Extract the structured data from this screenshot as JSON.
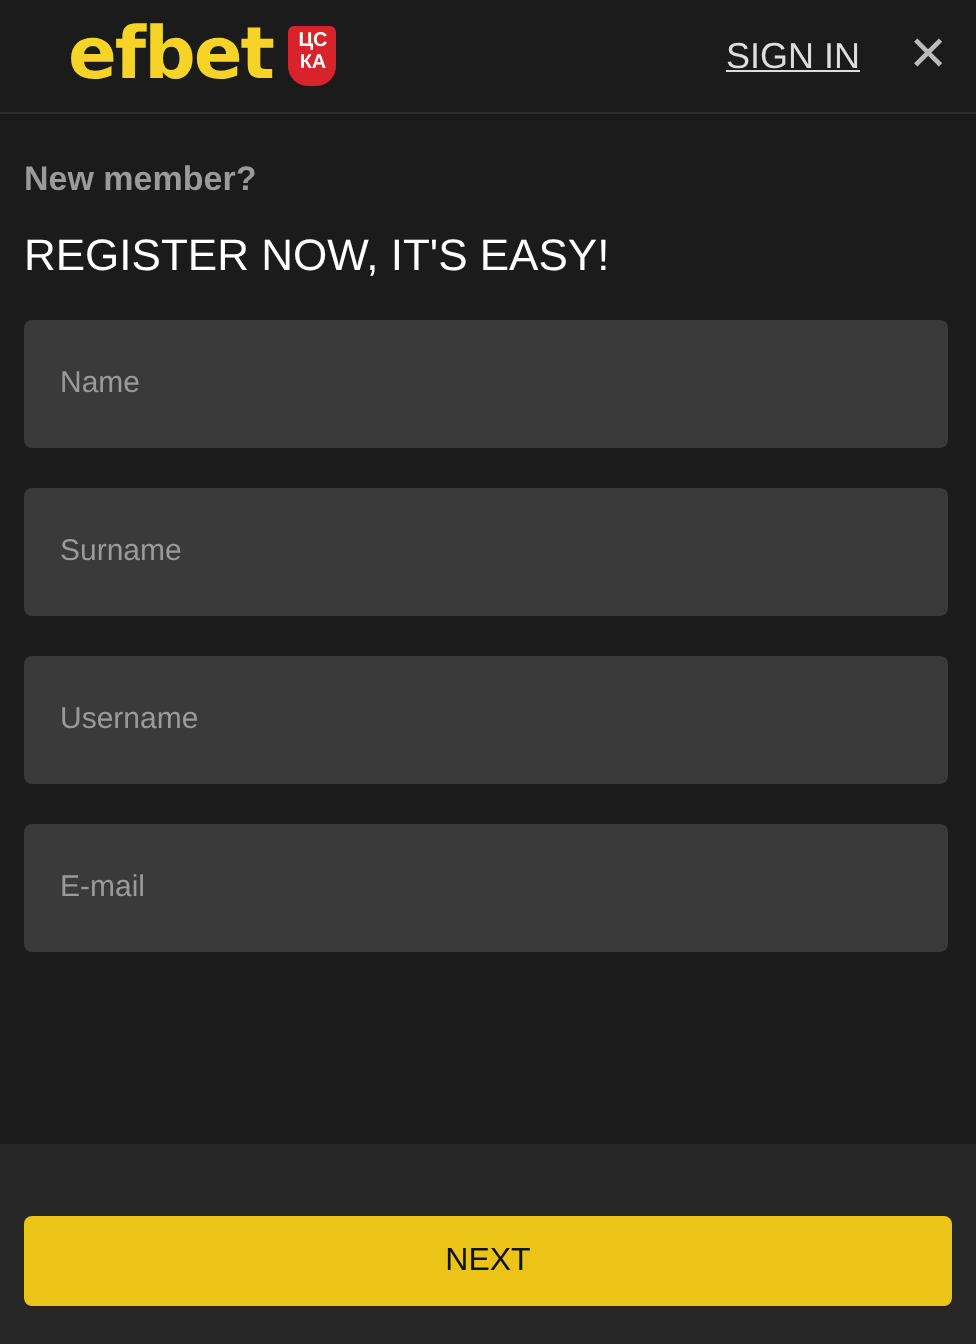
{
  "header": {
    "logo": "efbet",
    "badge": "ЦСКА",
    "sign_in": "SIGN IN",
    "close": "✕"
  },
  "intro": "New member?",
  "heading": "REGISTER NOW, IT'S EASY!",
  "fields": [
    {
      "placeholder": "Name"
    },
    {
      "placeholder": "Surname"
    },
    {
      "placeholder": "Username"
    },
    {
      "placeholder": "E-mail"
    }
  ],
  "button": "NEXT"
}
